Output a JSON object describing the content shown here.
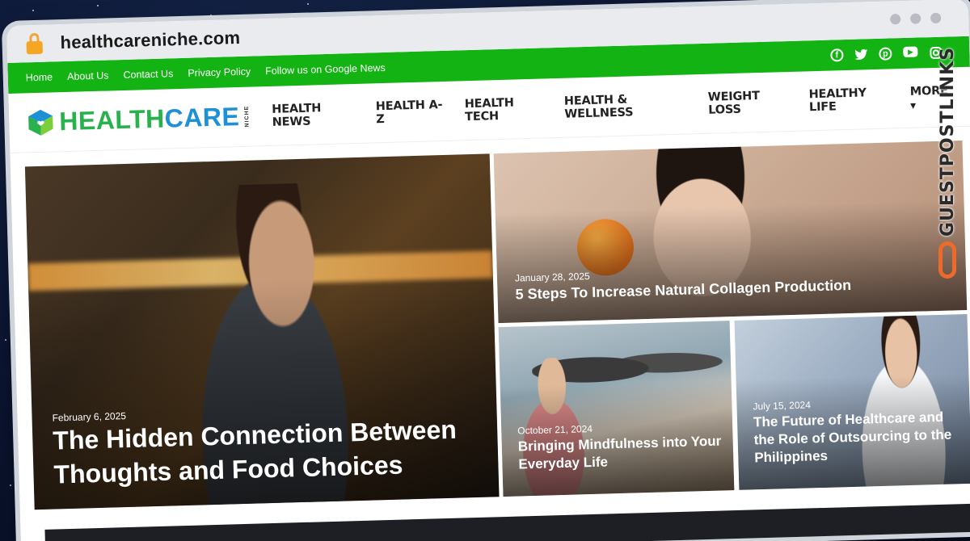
{
  "browser": {
    "url": "healthcareniche.com"
  },
  "topbar": {
    "links": [
      "Home",
      "About Us",
      "Contact Us",
      "Privacy Policy",
      "Follow us on Google News"
    ],
    "social": [
      "facebook-icon",
      "twitter-icon",
      "pinterest-icon",
      "youtube-icon",
      "instagram-icon"
    ]
  },
  "logo": {
    "part1": "HEALTH",
    "part2": "CARE",
    "niche": "NICHE"
  },
  "menu": {
    "items": [
      "HEALTH NEWS",
      "HEALTH A-Z",
      "HEALTH TECH",
      "HEALTH & WELLNESS",
      "WEIGHT LOSS",
      "HEALTHY LIFE",
      "MORE"
    ]
  },
  "posts": [
    {
      "date": "February 6, 2025",
      "title": "The Hidden Connection Between Thoughts and Food Choices"
    },
    {
      "date": "January 28, 2025",
      "title": "5 Steps To Increase Natural Collagen Production"
    },
    {
      "date": "October 21, 2024",
      "title": "Bringing Mindfulness into Your Everyday Life"
    },
    {
      "date": "July 15, 2024",
      "title": "The Future of Healthcare and the Role of Outsourcing to the Philippines"
    }
  ],
  "watermark": {
    "text": "GUESTPOSTLINKS"
  },
  "colors": {
    "topbar": "#14b314",
    "logo_green": "#28b14c",
    "logo_blue": "#1e90d6",
    "watermark_accent": "#ee6a2a"
  }
}
